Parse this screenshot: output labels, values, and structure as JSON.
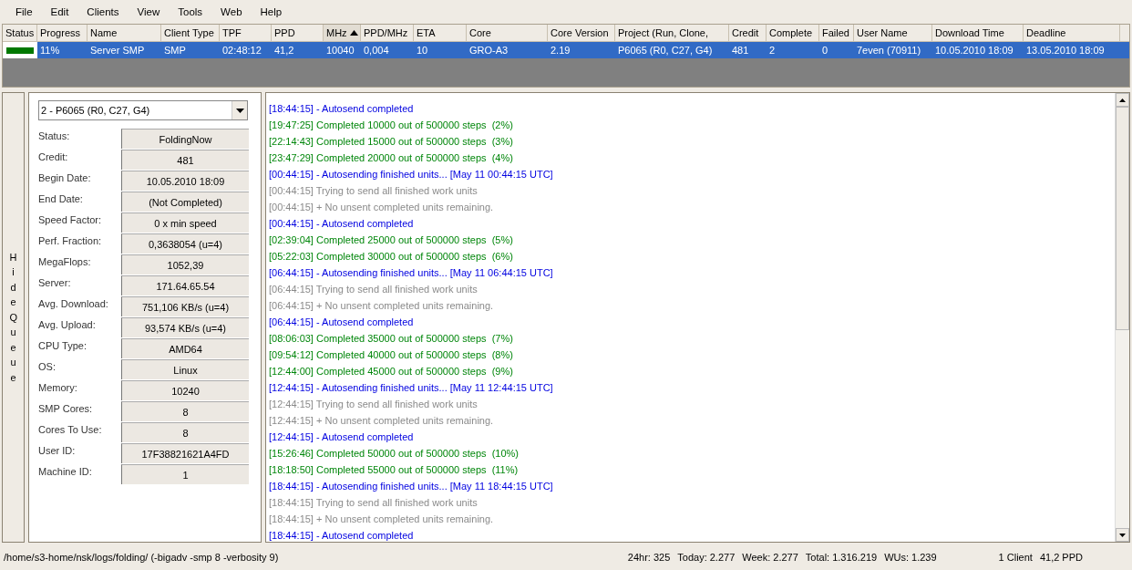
{
  "menu": [
    "File",
    "Edit",
    "Clients",
    "View",
    "Tools",
    "Web",
    "Help"
  ],
  "table": {
    "columns": [
      {
        "label": "Status",
        "sorted": false
      },
      {
        "label": "Progress",
        "sorted": false
      },
      {
        "label": "Name",
        "sorted": false
      },
      {
        "label": "Client Type",
        "sorted": false
      },
      {
        "label": "TPF",
        "sorted": false
      },
      {
        "label": "PPD",
        "sorted": false
      },
      {
        "label": "MHz",
        "sorted": true
      },
      {
        "label": "PPD/MHz",
        "sorted": false
      },
      {
        "label": "ETA",
        "sorted": false
      },
      {
        "label": "Core",
        "sorted": false
      },
      {
        "label": "Core Version",
        "sorted": false
      },
      {
        "label": "Project (Run, Clone,",
        "sorted": false
      },
      {
        "label": "Credit",
        "sorted": false
      },
      {
        "label": "Complete",
        "sorted": false
      },
      {
        "label": "Failed",
        "sorted": false
      },
      {
        "label": "User Name",
        "sorted": false
      },
      {
        "label": "Download Time",
        "sorted": false
      },
      {
        "label": "Deadline",
        "sorted": false
      }
    ],
    "rows": [
      {
        "selected": true,
        "color": "#007800",
        "cells": [
          "",
          "11%",
          "Server SMP",
          "SMP",
          "02:48:12",
          "41,2",
          "10040",
          "0,004",
          "10",
          "GRO-A3",
          "2.19",
          "P6065 (R0, C27, G4)",
          "481",
          "2",
          "0",
          "7even (70911)",
          "10.05.2010 18:09",
          "13.05.2010 18:09"
        ]
      }
    ]
  },
  "hide_queue": "Hide Queue",
  "queue": {
    "selector": "2 - P6065 (R0, C27, G4)",
    "fields": [
      {
        "label": "Status:",
        "value": "FoldingNow"
      },
      {
        "label": "Credit:",
        "value": "481"
      },
      {
        "label": "Begin Date:",
        "value": "10.05.2010 18:09"
      },
      {
        "label": "End Date:",
        "value": "(Not Completed)"
      },
      {
        "label": "Speed Factor:",
        "value": "0 x min speed"
      },
      {
        "label": "Perf. Fraction:",
        "value": "0,3638054 (u=4)"
      },
      {
        "label": "MegaFlops:",
        "value": "1052,39"
      },
      {
        "label": "Server:",
        "value": "171.64.65.54"
      },
      {
        "label": "Avg. Download:",
        "value": "751,106 KB/s (u=4)"
      },
      {
        "label": "Avg. Upload:",
        "value": "93,574 KB/s (u=4)"
      },
      {
        "label": "CPU Type:",
        "value": "AMD64"
      },
      {
        "label": "OS:",
        "value": "Linux"
      },
      {
        "label": "Memory:",
        "value": "10240"
      },
      {
        "label": "SMP Cores:",
        "value": "8"
      },
      {
        "label": "Cores To Use:",
        "value": "8"
      },
      {
        "label": "User ID:",
        "value": "17F38821621A4FD"
      },
      {
        "label": "Machine ID:",
        "value": "1"
      }
    ]
  },
  "log": [
    {
      "kind": "info",
      "text": "[18:44:15] - Autosend completed"
    },
    {
      "kind": "progress",
      "text": "[19:47:25] Completed 10000 out of 500000 steps  (2%)"
    },
    {
      "kind": "progress",
      "text": "[22:14:43] Completed 15000 out of 500000 steps  (3%)"
    },
    {
      "kind": "progress",
      "text": "[23:47:29] Completed 20000 out of 500000 steps  (4%)"
    },
    {
      "kind": "info",
      "text": "[00:44:15] - Autosending finished units... [May 11 00:44:15 UTC]"
    },
    {
      "kind": "plain",
      "text": "[00:44:15] Trying to send all finished work units"
    },
    {
      "kind": "plain",
      "text": "[00:44:15] + No unsent completed units remaining."
    },
    {
      "kind": "info",
      "text": "[00:44:15] - Autosend completed"
    },
    {
      "kind": "progress",
      "text": "[02:39:04] Completed 25000 out of 500000 steps  (5%)"
    },
    {
      "kind": "progress",
      "text": "[05:22:03] Completed 30000 out of 500000 steps  (6%)"
    },
    {
      "kind": "info",
      "text": "[06:44:15] - Autosending finished units... [May 11 06:44:15 UTC]"
    },
    {
      "kind": "plain",
      "text": "[06:44:15] Trying to send all finished work units"
    },
    {
      "kind": "plain",
      "text": "[06:44:15] + No unsent completed units remaining."
    },
    {
      "kind": "info",
      "text": "[06:44:15] - Autosend completed"
    },
    {
      "kind": "progress",
      "text": "[08:06:03] Completed 35000 out of 500000 steps  (7%)"
    },
    {
      "kind": "progress",
      "text": "[09:54:12] Completed 40000 out of 500000 steps  (8%)"
    },
    {
      "kind": "progress",
      "text": "[12:44:00] Completed 45000 out of 500000 steps  (9%)"
    },
    {
      "kind": "info",
      "text": "[12:44:15] - Autosending finished units... [May 11 12:44:15 UTC]"
    },
    {
      "kind": "plain",
      "text": "[12:44:15] Trying to send all finished work units"
    },
    {
      "kind": "plain",
      "text": "[12:44:15] + No unsent completed units remaining."
    },
    {
      "kind": "info",
      "text": "[12:44:15] - Autosend completed"
    },
    {
      "kind": "progress",
      "text": "[15:26:46] Completed 50000 out of 500000 steps  (10%)"
    },
    {
      "kind": "progress",
      "text": "[18:18:50] Completed 55000 out of 500000 steps  (11%)"
    },
    {
      "kind": "info",
      "text": "[18:44:15] - Autosending finished units... [May 11 18:44:15 UTC]"
    },
    {
      "kind": "plain",
      "text": "[18:44:15] Trying to send all finished work units"
    },
    {
      "kind": "plain",
      "text": "[18:44:15] + No unsent completed units remaining."
    },
    {
      "kind": "info",
      "text": "[18:44:15] - Autosend completed"
    }
  ],
  "status_bar": {
    "path": "/home/s3-home/nsk/logs/folding/ (-bigadv -smp 8 -verbosity 9)",
    "stats": [
      "24hr: 325",
      "Today: 2.277",
      "Week: 2.277",
      "Total: 1.316.219",
      "WUs: 1.239"
    ],
    "clients": "1 Client",
    "ppd": "41,2 PPD"
  }
}
